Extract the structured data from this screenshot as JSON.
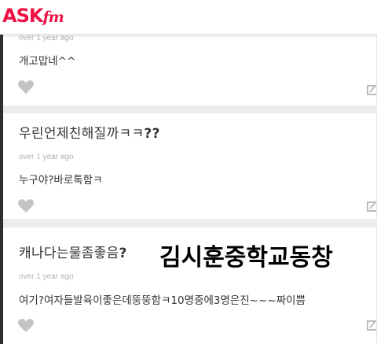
{
  "header": {
    "logo_main": "ASK",
    "logo_suffix": "fm"
  },
  "posts": [
    {
      "time": "over 1 year ago",
      "answer": "개고맙네^^"
    },
    {
      "question": "우린언제친해질까ㅋㅋ",
      "question_suffix": "??",
      "time": "over 1 year ago",
      "answer": "누구야?바로톡함ㅋ"
    },
    {
      "question": "캐나다는물좀좋음",
      "question_suffix": "?",
      "time": "over 1 year ago",
      "answer": "여기?여자들발육이좋은데뚱뚱함ㅋ10명중에3명은진~~~짜이쁨"
    }
  ],
  "overlay_caption": "김시훈중학교동창",
  "colors": {
    "brand": "#ee1144",
    "icon_gray": "#c4c4c4",
    "timestamp": "#b3b3b3"
  },
  "icons": [
    "heart-icon",
    "edit-icon"
  ]
}
